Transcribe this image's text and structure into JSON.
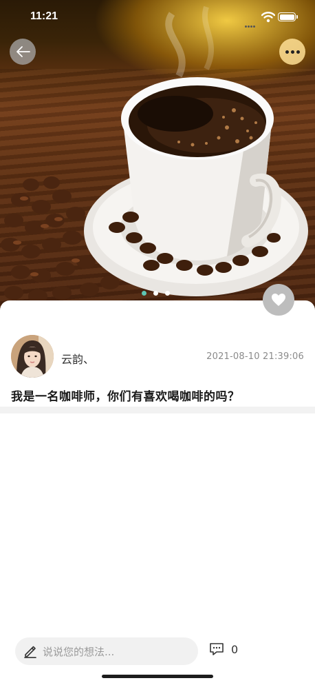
{
  "status_bar": {
    "time": "11:21"
  },
  "hero": {
    "image": "coffee-cup-photo",
    "carousel_pages": 3,
    "active_page": 1
  },
  "icons": {
    "back": "arrow-left-icon",
    "more": "more-dots-icon",
    "favorite": "heart-icon",
    "edit": "pencil-icon",
    "comment": "comment-bubble-icon"
  },
  "post": {
    "author": "云韵、",
    "datetime": "2021-08-10 21:39:06",
    "text": "我是一名咖啡师，你们有喜欢喝咖啡的吗？"
  },
  "comment_bar": {
    "placeholder": "说说您的想法...",
    "comment_count": "0"
  },
  "colors": {
    "accent_dot": "#5ec6b4",
    "input_bg": "#f1f1f1",
    "divider": "#f2f2f2"
  }
}
